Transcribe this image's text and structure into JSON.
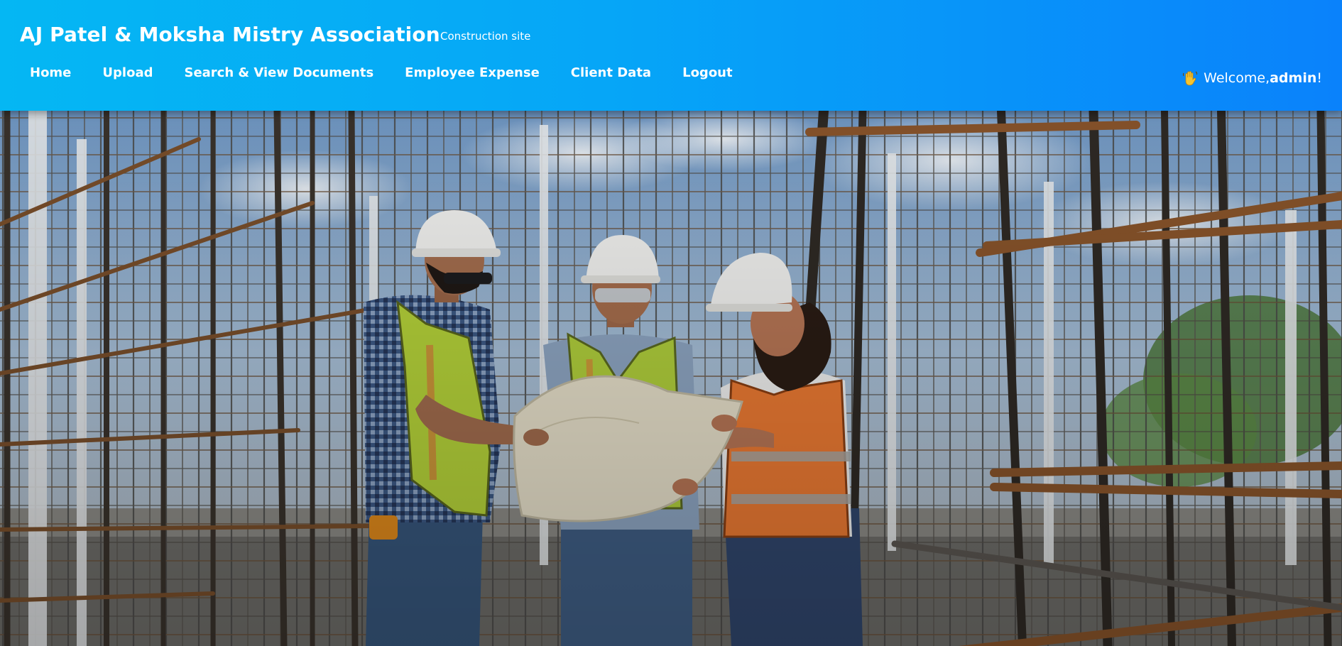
{
  "header": {
    "brand": "AJ Patel & Moksha Mistry Association",
    "subtitle": "Construction site",
    "nav": [
      {
        "label": "Home"
      },
      {
        "label": "Upload"
      },
      {
        "label": "Search & View Documents"
      },
      {
        "label": "Employee Expense"
      },
      {
        "label": "Client Data"
      },
      {
        "label": "Logout"
      }
    ],
    "welcome": {
      "prefix": "Welcome, ",
      "username": "admin",
      "suffix": "!",
      "icon": "waving-hand-icon"
    }
  },
  "hero": {
    "icon": "construction-site-photo"
  },
  "colors": {
    "header_gradient_start": "#05b7f3",
    "header_gradient_end": "#0a82fb",
    "text": "#ffffff"
  }
}
